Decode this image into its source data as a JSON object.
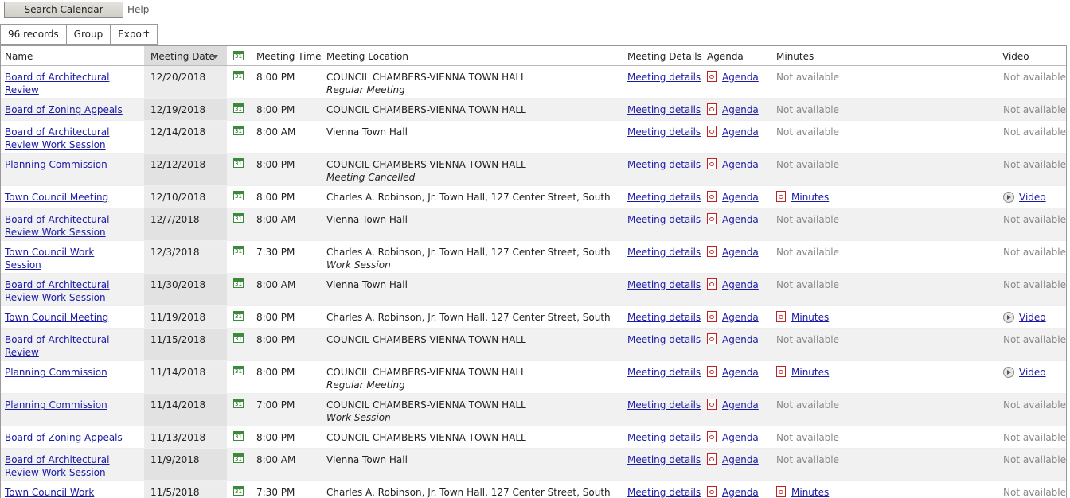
{
  "top": {
    "search_label": "Search Calendar",
    "help_label": "Help"
  },
  "toolbar": {
    "records": "96 records",
    "group": "Group",
    "export": "Export"
  },
  "columns": {
    "name": "Name",
    "date": "Meeting Date",
    "time": "Meeting Time",
    "location": "Meeting Location",
    "details": "Meeting Details",
    "agenda": "Agenda",
    "minutes": "Minutes",
    "video": "Video"
  },
  "rows": [
    {
      "name": "Board of Architectural Review",
      "date": "12/20/2018",
      "time": "8:00 PM",
      "location": "COUNCIL CHAMBERS-VIENNA TOWN HALL",
      "sub": "Regular Meeting",
      "details": "Meeting details",
      "agenda": "Agenda",
      "minutes": "Not available",
      "minutes_link": false,
      "video": "Not available",
      "video_link": false
    },
    {
      "name": "Board of Zoning Appeals",
      "date": "12/19/2018",
      "time": "8:00 PM",
      "location": "COUNCIL CHAMBERS-VIENNA TOWN HALL",
      "sub": "",
      "details": "Meeting details",
      "agenda": "Agenda",
      "minutes": "Not available",
      "minutes_link": false,
      "video": "Not available",
      "video_link": false
    },
    {
      "name": "Board of Architectural Review Work Session",
      "date": "12/14/2018",
      "time": "8:00 AM",
      "location": "Vienna Town Hall",
      "sub": "",
      "details": "Meeting details",
      "agenda": "Agenda",
      "minutes": "Not available",
      "minutes_link": false,
      "video": "Not available",
      "video_link": false
    },
    {
      "name": "Planning Commission",
      "date": "12/12/2018",
      "time": "8:00 PM",
      "location": "COUNCIL CHAMBERS-VIENNA TOWN HALL",
      "sub": "Meeting Cancelled",
      "details": "Meeting details",
      "agenda": "Agenda",
      "minutes": "Not available",
      "minutes_link": false,
      "video": "Not available",
      "video_link": false
    },
    {
      "name": "Town Council Meeting",
      "date": "12/10/2018",
      "time": "8:00 PM",
      "location": "Charles A. Robinson, Jr. Town Hall, 127 Center Street, South",
      "sub": "",
      "details": "Meeting details",
      "agenda": "Agenda",
      "minutes": "Minutes",
      "minutes_link": true,
      "video": "Video",
      "video_link": true
    },
    {
      "name": "Board of Architectural Review Work Session",
      "date": "12/7/2018",
      "time": "8:00 AM",
      "location": "Vienna Town Hall",
      "sub": "",
      "details": "Meeting details",
      "agenda": "Agenda",
      "minutes": "Not available",
      "minutes_link": false,
      "video": "Not available",
      "video_link": false
    },
    {
      "name": "Town Council Work Session",
      "date": "12/3/2018",
      "time": "7:30 PM",
      "location": "Charles A. Robinson, Jr. Town Hall, 127 Center Street, South",
      "sub": "Work Session",
      "details": "Meeting details",
      "agenda": "Agenda",
      "minutes": "Not available",
      "minutes_link": false,
      "video": "Not available",
      "video_link": false
    },
    {
      "name": "Board of Architectural Review Work Session",
      "date": "11/30/2018",
      "time": "8:00 AM",
      "location": "Vienna Town Hall",
      "sub": "",
      "details": "Meeting details",
      "agenda": "Agenda",
      "minutes": "Not available",
      "minutes_link": false,
      "video": "Not available",
      "video_link": false
    },
    {
      "name": "Town Council Meeting",
      "date": "11/19/2018",
      "time": "8:00 PM",
      "location": "Charles A. Robinson, Jr. Town Hall, 127 Center Street, South",
      "sub": "",
      "details": "Meeting details",
      "agenda": "Agenda",
      "minutes": "Minutes",
      "minutes_link": true,
      "video": "Video",
      "video_link": true
    },
    {
      "name": "Board of Architectural Review",
      "date": "11/15/2018",
      "time": "8:00 PM",
      "location": "COUNCIL CHAMBERS-VIENNA TOWN HALL",
      "sub": "",
      "details": "Meeting details",
      "agenda": "Agenda",
      "minutes": "Not available",
      "minutes_link": false,
      "video": "Not available",
      "video_link": false
    },
    {
      "name": "Planning Commission",
      "date": "11/14/2018",
      "time": "8:00 PM",
      "location": "COUNCIL CHAMBERS-VIENNA TOWN HALL",
      "sub": "Regular Meeting",
      "details": "Meeting details",
      "agenda": "Agenda",
      "minutes": "Minutes",
      "minutes_link": true,
      "video": "Video",
      "video_link": true
    },
    {
      "name": "Planning Commission",
      "date": "11/14/2018",
      "time": "7:00 PM",
      "location": "COUNCIL CHAMBERS-VIENNA TOWN HALL",
      "sub": "Work Session",
      "details": "Meeting details",
      "agenda": "Agenda",
      "minutes": "Not available",
      "minutes_link": false,
      "video": "Not available",
      "video_link": false
    },
    {
      "name": "Board of Zoning Appeals",
      "date": "11/13/2018",
      "time": "8:00 PM",
      "location": "COUNCIL CHAMBERS-VIENNA TOWN HALL",
      "sub": "",
      "details": "Meeting details",
      "agenda": "Agenda",
      "minutes": "Not available",
      "minutes_link": false,
      "video": "Not available",
      "video_link": false
    },
    {
      "name": "Board of Architectural Review Work Session",
      "date": "11/9/2018",
      "time": "8:00 AM",
      "location": "Vienna Town Hall",
      "sub": "",
      "details": "Meeting details",
      "agenda": "Agenda",
      "minutes": "Not available",
      "minutes_link": false,
      "video": "Not available",
      "video_link": false
    },
    {
      "name": "Town Council Work Session",
      "date": "11/5/2018",
      "time": "7:30 PM",
      "location": "Charles A. Robinson, Jr. Town Hall, 127 Center Street, South",
      "sub": "",
      "details": "Meeting details",
      "agenda": "Agenda",
      "minutes": "Minutes",
      "minutes_link": true,
      "video": "Not available",
      "video_link": false
    }
  ]
}
